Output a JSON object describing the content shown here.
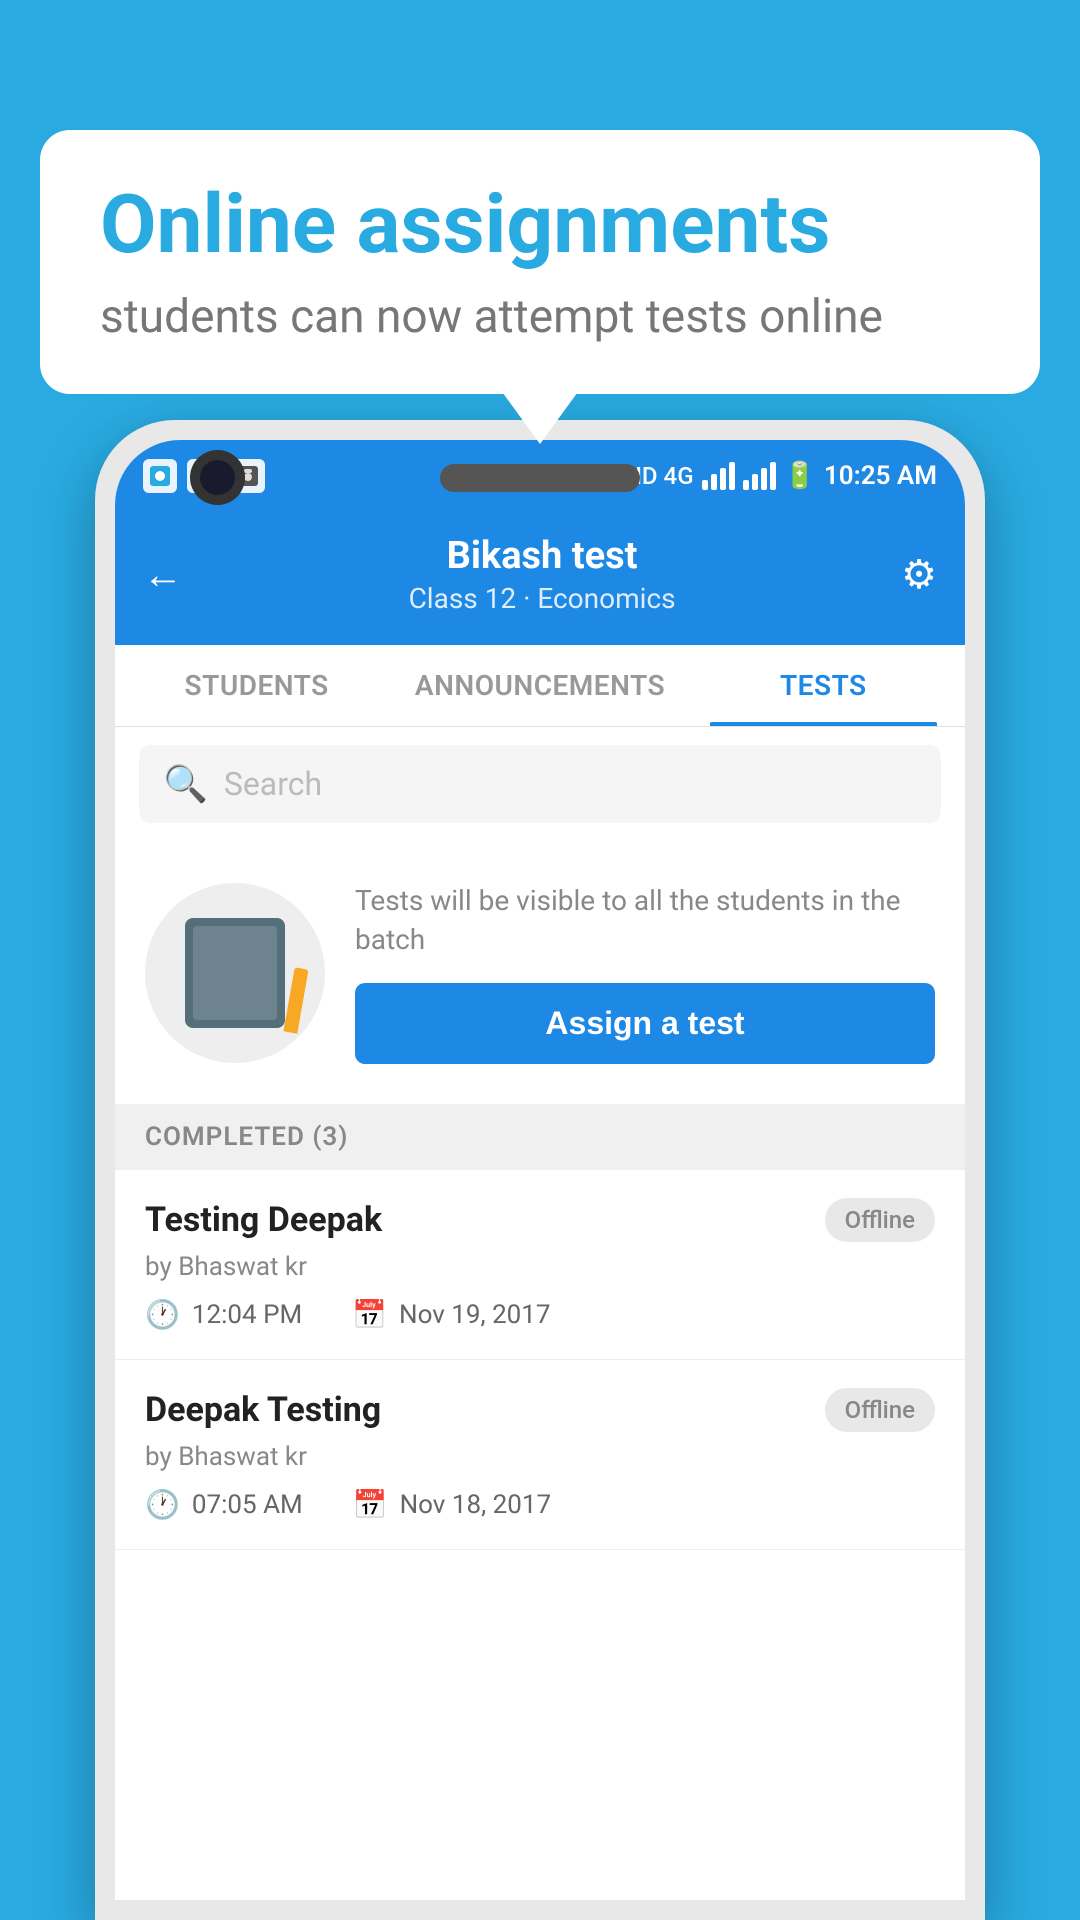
{
  "background_color": "#29ABE2",
  "speech_bubble": {
    "title": "Online assignments",
    "subtitle": "students can now attempt tests online"
  },
  "status_bar": {
    "time": "10:25 AM",
    "network": "HD 4G"
  },
  "app_bar": {
    "title": "Bikash test",
    "subtitle": "Class 12 · Economics",
    "back_label": "←",
    "settings_label": "⚙"
  },
  "tabs": [
    {
      "label": "STUDENTS",
      "active": false
    },
    {
      "label": "ANNOUNCEMENTS",
      "active": false
    },
    {
      "label": "TESTS",
      "active": true
    }
  ],
  "search": {
    "placeholder": "Search"
  },
  "assign_section": {
    "description": "Tests will be visible to all the students in the batch",
    "button_label": "Assign a test"
  },
  "completed_section": {
    "header": "COMPLETED (3)",
    "items": [
      {
        "name": "Testing Deepak",
        "author": "by Bhaswat kr",
        "time": "12:04 PM",
        "date": "Nov 19, 2017",
        "status": "Offline"
      },
      {
        "name": "Deepak Testing",
        "author": "by Bhaswat kr",
        "time": "07:05 AM",
        "date": "Nov 18, 2017",
        "status": "Offline"
      }
    ]
  }
}
